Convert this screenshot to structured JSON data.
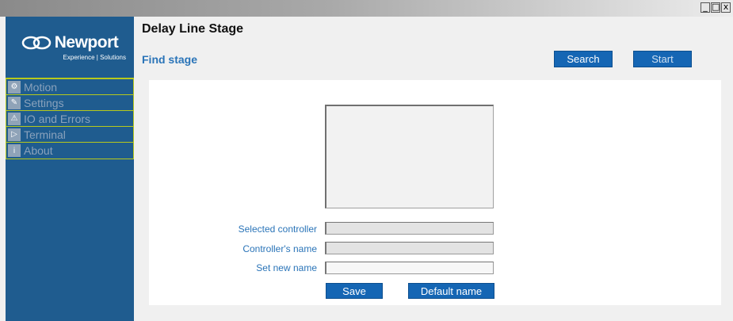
{
  "window": {
    "controls": {
      "minimize": "_",
      "maximize": "□",
      "close": "x"
    }
  },
  "brand": {
    "name": "Newport",
    "tagline": "Experience | Solutions"
  },
  "sidebar": {
    "items": [
      {
        "label": "Motion",
        "icon": "gear-icon"
      },
      {
        "label": "Settings",
        "icon": "wrench-icon"
      },
      {
        "label": "IO and Errors",
        "icon": "warning-icon"
      },
      {
        "label": "Terminal",
        "icon": "terminal-icon"
      },
      {
        "label": "About",
        "icon": "info-icon"
      }
    ]
  },
  "header": {
    "title": "Delay Line Stage",
    "section": "Find stage"
  },
  "toolbar": {
    "search_label": "Search",
    "start_label": "Start"
  },
  "form": {
    "selected_controller_label": "Selected controller",
    "selected_controller_value": "",
    "controller_name_label": "Controller's name",
    "controller_name_value": "",
    "new_name_label": "Set new name",
    "new_name_value": "",
    "save_label": "Save",
    "default_name_label": "Default name"
  },
  "colors": {
    "sidebar_bg": "#1f5c8f",
    "accent": "#2a74b8",
    "button_bg": "#1566b4",
    "nav_border": "#b7c91c"
  }
}
